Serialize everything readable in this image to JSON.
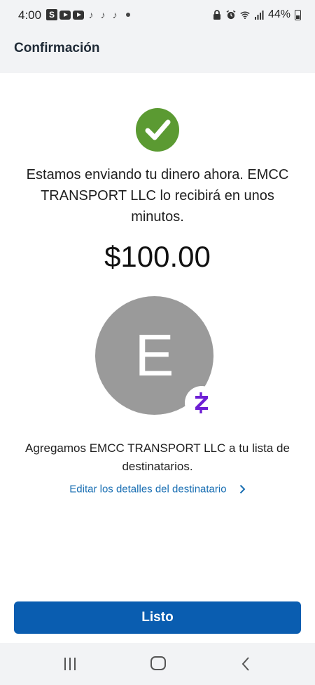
{
  "status_bar": {
    "time": "4:00",
    "s_icon_label": "S",
    "battery_percent": "44%",
    "icons_left": [
      "s-app-icon",
      "youtube-icon",
      "youtube-icon",
      "tiktok-icon",
      "tiktok-icon",
      "tiktok-icon",
      "dot-icon"
    ],
    "icons_right": [
      "lock-icon",
      "alarm-icon",
      "wifi-icon",
      "signal-icon",
      "battery-icon"
    ]
  },
  "header": {
    "title": "Confirmación"
  },
  "main": {
    "success_icon": "checkmark-icon",
    "message": "Estamos enviando tu dinero ahora. EMCC TRANSPORT LLC lo recibirá en unos minutos.",
    "amount": "$100.00",
    "avatar_letter": "E",
    "badge_icon": "zelle-icon",
    "added_text": "Agregamos EMCC TRANSPORT LLC a tu lista de destinatarios.",
    "edit_link": "Editar los detalles del destinatario"
  },
  "footer": {
    "done_label": "Listo"
  },
  "nav_bar": {
    "icons": [
      "recent-apps-icon",
      "home-icon",
      "back-icon"
    ]
  },
  "colors": {
    "success_green": "#5b9a32",
    "primary_blue": "#0a5db0",
    "link_blue": "#1a6fb3",
    "avatar_gray": "#9a9a9a",
    "zelle_purple": "#6d1ed4"
  }
}
